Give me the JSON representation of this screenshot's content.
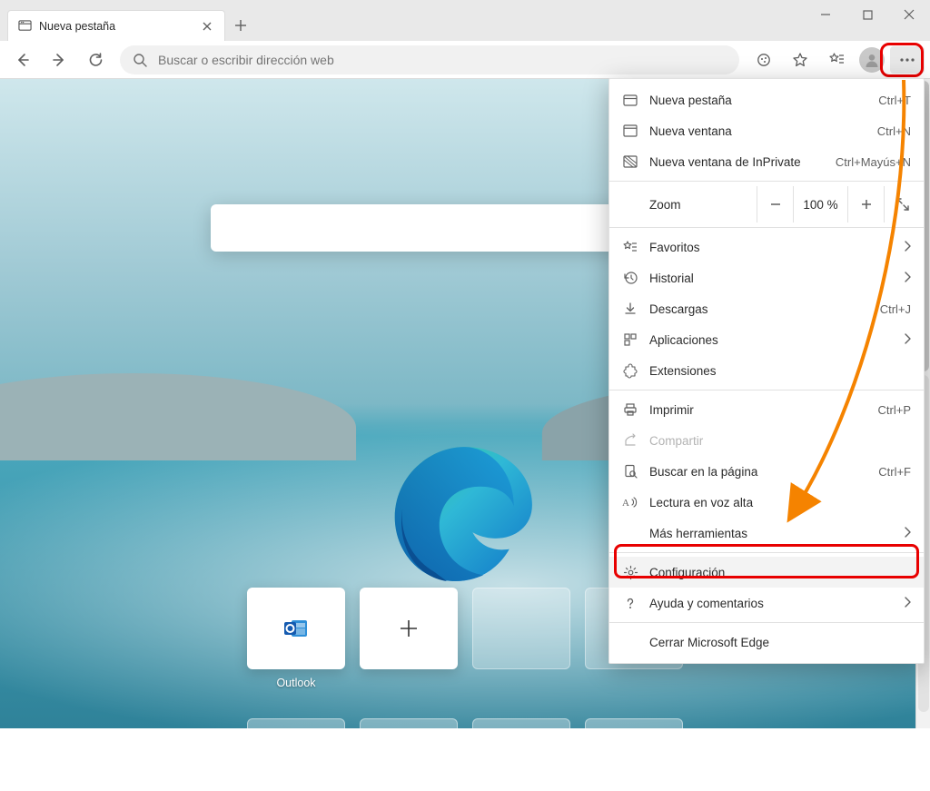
{
  "window": {
    "title": "Nueva pestaña"
  },
  "tab": {
    "title": "Nueva pestaña"
  },
  "omnibox": {
    "placeholder": "Buscar o escribir dirección web"
  },
  "zoom": {
    "label": "Zoom",
    "value": "100 %"
  },
  "menu": {
    "new_tab": {
      "label": "Nueva pestaña",
      "shortcut": "Ctrl+T"
    },
    "new_window": {
      "label": "Nueva ventana",
      "shortcut": "Ctrl+N"
    },
    "inprivate": {
      "label": "Nueva ventana de InPrivate",
      "shortcut": "Ctrl+Mayús+N"
    },
    "favorites": {
      "label": "Favoritos"
    },
    "history": {
      "label": "Historial"
    },
    "downloads": {
      "label": "Descargas",
      "shortcut": "Ctrl+J"
    },
    "apps": {
      "label": "Aplicaciones"
    },
    "extensions": {
      "label": "Extensiones"
    },
    "print": {
      "label": "Imprimir",
      "shortcut": "Ctrl+P"
    },
    "share": {
      "label": "Compartir"
    },
    "find": {
      "label": "Buscar en la página",
      "shortcut": "Ctrl+F"
    },
    "read_aloud": {
      "label": "Lectura en voz alta"
    },
    "more_tools": {
      "label": "Más herramientas"
    },
    "settings": {
      "label": "Configuración"
    },
    "help": {
      "label": "Ayuda y comentarios"
    },
    "close_edge": {
      "label": "Cerrar Microsoft Edge"
    }
  },
  "ntp": {
    "quicklinks": {
      "outlook": "Outlook"
    }
  }
}
